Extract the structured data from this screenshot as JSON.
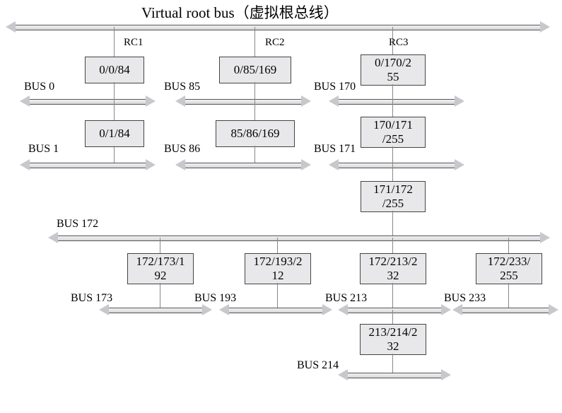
{
  "title": "Virtual root bus（虚拟根总线）",
  "rc_labels": {
    "rc1": "RC1",
    "rc2": "RC2",
    "rc3": "RC3"
  },
  "nodes": {
    "rc1_a": "0/0/84",
    "rc1_b": "0/1/84",
    "rc2_a": "0/85/169",
    "rc2_b": "85/86/169",
    "rc3_a1": "0/170/2",
    "rc3_a2": "55",
    "rc3_b1": "170/171",
    "rc3_b2": "/255",
    "rc3_c1": "171/172",
    "rc3_c2": "/255",
    "sw1_1": "172/173/1",
    "sw1_2": "92",
    "sw2_1": "172/193/2",
    "sw2_2": "12",
    "sw3_1": "172/213/2",
    "sw3_2": "32",
    "sw4_1": "172/233/",
    "sw4_2": "255",
    "sw5_1": "213/214/2",
    "sw5_2": "32"
  },
  "bus_labels": {
    "b0": "BUS 0",
    "b1": "BUS 1",
    "b85": "BUS 85",
    "b86": "BUS 86",
    "b170": "BUS 170",
    "b171": "BUS 171",
    "b172": "BUS 172",
    "b173": "BUS 173",
    "b193": "BUS 193",
    "b213": "BUS 213",
    "b214": "BUS 214",
    "b233": "BUS 233"
  },
  "chart_data": {
    "type": "table",
    "description": "PCI/PCIe bus enumeration tree under a virtual root bus, three Root Complexes (RC1/RC2/RC3). Each box is primary/secondary/subordinate bus numbers.",
    "root": "Virtual root bus（虚拟根总线）",
    "root_complexes": [
      {
        "name": "RC1",
        "bridges": [
          {
            "triple": "0/0/84",
            "downstream_bus": "BUS 0"
          },
          {
            "triple": "0/1/84",
            "downstream_bus": "BUS 1"
          }
        ]
      },
      {
        "name": "RC2",
        "bridges": [
          {
            "triple": "0/85/169",
            "downstream_bus": "BUS 85"
          },
          {
            "triple": "85/86/169",
            "downstream_bus": "BUS 86"
          }
        ]
      },
      {
        "name": "RC3",
        "bridges": [
          {
            "triple": "0/170/255",
            "downstream_bus": "BUS 170"
          },
          {
            "triple": "170/171/255",
            "downstream_bus": "BUS 171"
          },
          {
            "triple": "171/172/255",
            "downstream_bus": "BUS 172",
            "children_on_bus_172": [
              {
                "triple": "172/173/192",
                "downstream_bus": "BUS 173"
              },
              {
                "triple": "172/193/212",
                "downstream_bus": "BUS 193"
              },
              {
                "triple": "172/213/232",
                "downstream_bus": "BUS 213",
                "children_on_bus_213": [
                  {
                    "triple": "213/214/232",
                    "downstream_bus": "BUS 214"
                  }
                ]
              },
              {
                "triple": "172/233/255",
                "downstream_bus": "BUS 233"
              }
            ]
          }
        ]
      }
    ]
  }
}
